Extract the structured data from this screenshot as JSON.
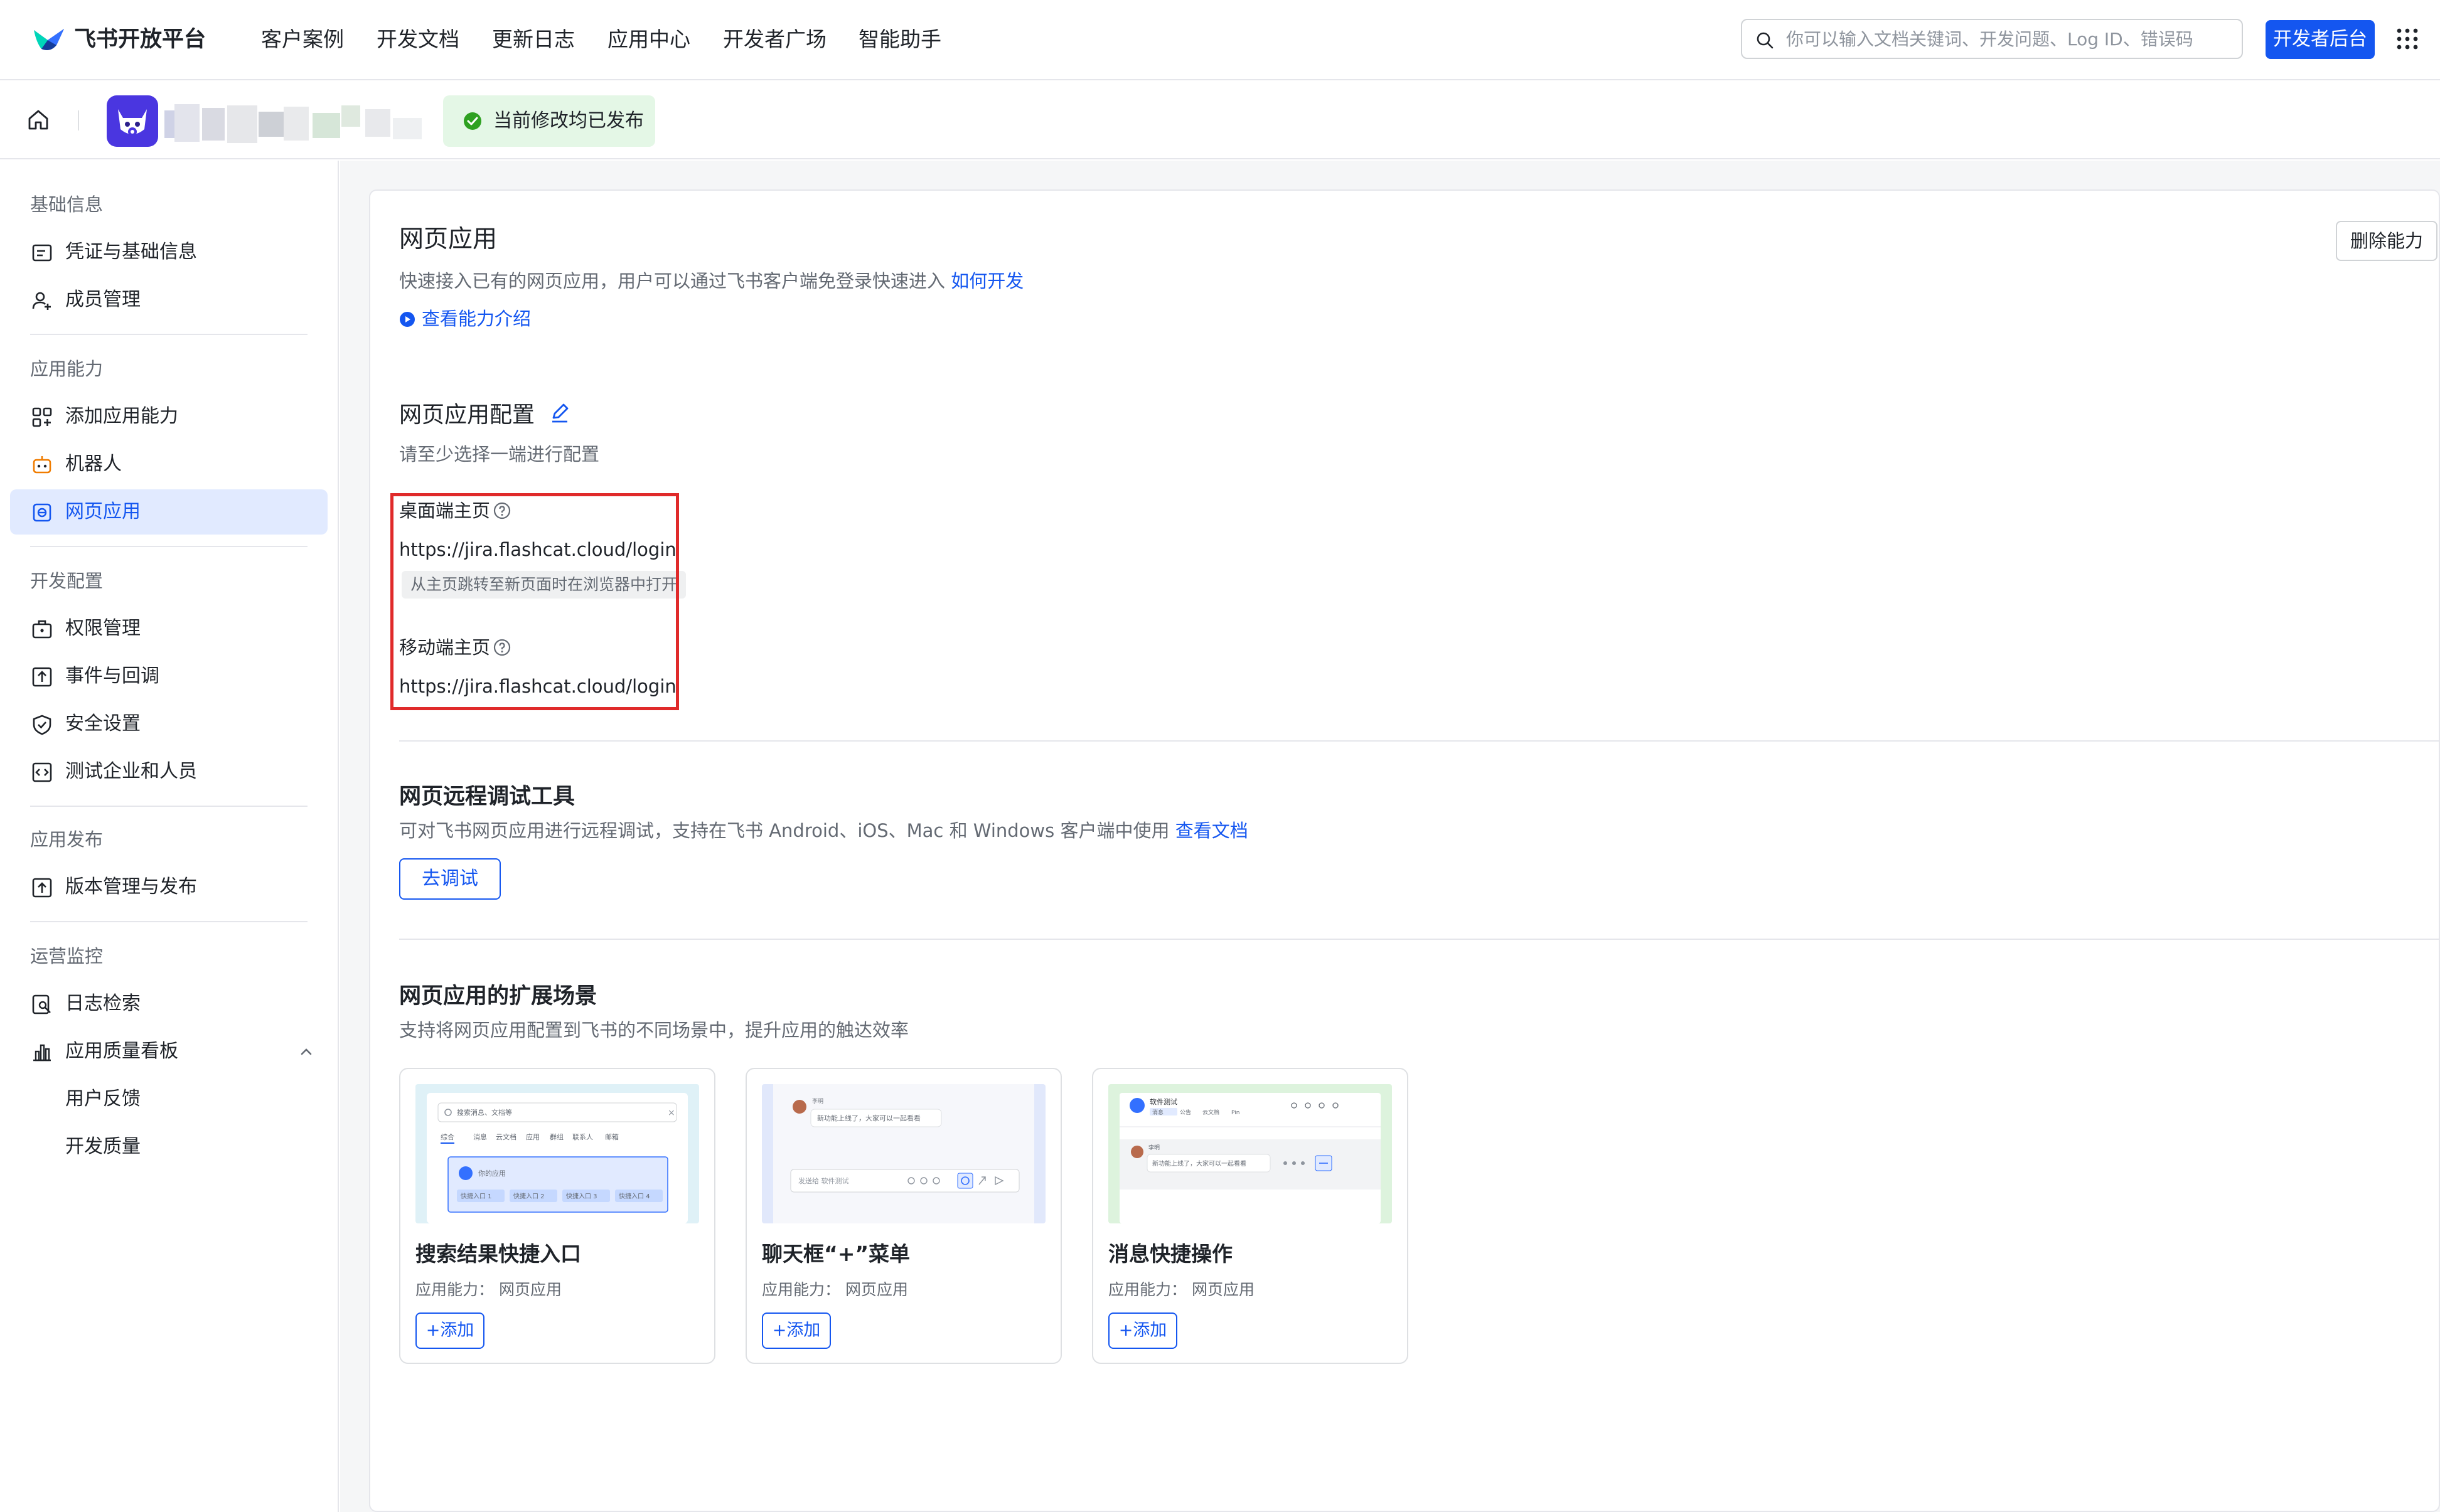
{
  "brand": {
    "name": "飞书开放平台"
  },
  "nav": {
    "links": [
      "客户案例",
      "开发文档",
      "更新日志",
      "应用中心",
      "开发者广场",
      "智能助手"
    ],
    "search_placeholder": "你可以输入文档关键词、开发问题、Log ID、错误码",
    "dev_console": "开发者后台"
  },
  "appbar": {
    "status": "当前修改均已发布"
  },
  "sidebar": {
    "sections": [
      {
        "title": "基础信息",
        "items": [
          "凭证与基础信息",
          "成员管理"
        ]
      },
      {
        "title": "应用能力",
        "items": [
          "添加应用能力",
          "机器人",
          "网页应用"
        ]
      },
      {
        "title": "开发配置",
        "items": [
          "权限管理",
          "事件与回调",
          "安全设置",
          "测试企业和人员"
        ]
      },
      {
        "title": "应用发布",
        "items": [
          "版本管理与发布"
        ]
      },
      {
        "title": "运营监控",
        "items": [
          "日志检索",
          "应用质量看板"
        ]
      }
    ],
    "sub_items": [
      "用户反馈",
      "开发质量"
    ],
    "active": "网页应用"
  },
  "main": {
    "title": "网页应用",
    "desc": "快速接入已有的网页应用，用户可以通过飞书客户端免登录快速进入",
    "how_link": "如何开发",
    "intro_link": "查看能力介绍",
    "delete_button": "删除能力",
    "config": {
      "title": "网页应用配置",
      "hint": "请至少选择一端进行配置",
      "desktop_label": "桌面端主页",
      "desktop_url": "https://jira.flashcat.cloud/login",
      "desktop_tag": "从主页跳转至新页面时在浏览器中打开",
      "mobile_label": "移动端主页",
      "mobile_url": "https://jira.flashcat.cloud/login"
    },
    "debug": {
      "title": "网页远程调试工具",
      "desc": "可对飞书网页应用进行远程调试，支持在飞书 Android、iOS、Mac 和 Windows 客户端中使用",
      "doc_link": "查看文档",
      "button": "去调试"
    },
    "scenes": {
      "title": "网页应用的扩展场景",
      "desc": "支持将网页应用配置到飞书的不同场景中，提升应用的触达效率",
      "cards": [
        {
          "title": "搜索结果快捷入口",
          "caption": "应用能力：  网页应用",
          "add": "添加"
        },
        {
          "title": "聊天框“+”菜单",
          "caption": "应用能力：  网页应用",
          "add": "添加"
        },
        {
          "title": "消息快捷操作",
          "caption": "应用能力：  网页应用",
          "add": "添加"
        }
      ]
    },
    "thumbs": {
      "search_placeholder": "搜索消息、文档等",
      "search_tabs": [
        "综合",
        "消息",
        "云文档",
        "应用",
        "群组",
        "联系人",
        "邮箱"
      ],
      "my_app": "你的应用",
      "shortcuts": [
        "快捷入口 1",
        "快捷入口 2",
        "快捷入口 3",
        "快捷入口 4"
      ],
      "sender": "李明",
      "chat_message": "新功能上线了，大家可以一起看看",
      "chat_input": "发送给 软件测试",
      "group_name": "软件测试",
      "group_tabs": [
        "消息",
        "公告",
        "云文档",
        "Pin"
      ]
    }
  }
}
